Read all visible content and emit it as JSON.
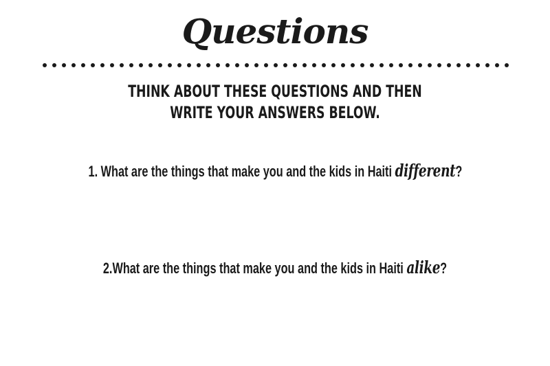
{
  "header": {
    "title": "Questions"
  },
  "instructions": {
    "line1": "THINK ABOUT THESE QUESTIONS AND THEN",
    "line2": "WRITE YOUR ANSWERS BELOW."
  },
  "questions": [
    {
      "prefix": "1. What are the things that make you and the kids in Haiti ",
      "emphasis": "different",
      "suffix": "?"
    },
    {
      "prefix": "2.What are the things that make you and the kids in Haiti ",
      "emphasis": "alike",
      "suffix": "?"
    }
  ]
}
